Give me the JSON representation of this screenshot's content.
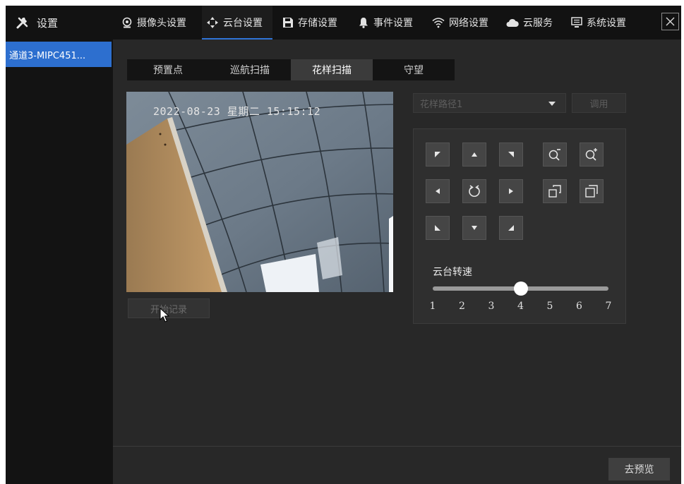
{
  "app": {
    "title": "设置"
  },
  "topnav": {
    "tabs": [
      {
        "label": "摄像头设置",
        "icon": "camera-icon"
      },
      {
        "label": "云台设置",
        "icon": "ptz-icon",
        "active": true
      },
      {
        "label": "存储设置",
        "icon": "floppy-icon"
      },
      {
        "label": "事件设置",
        "icon": "bell-icon"
      },
      {
        "label": "网络设置",
        "icon": "wifi-icon"
      },
      {
        "label": "云服务",
        "icon": "cloud-icon"
      },
      {
        "label": "系统设置",
        "icon": "monitor-icon"
      }
    ]
  },
  "sidebar": {
    "items": [
      {
        "label": "通道3-MIPC451..."
      }
    ]
  },
  "subtabs": [
    {
      "label": "预置点"
    },
    {
      "label": "巡航扫描"
    },
    {
      "label": "花样扫描",
      "active": true
    },
    {
      "label": "守望"
    }
  ],
  "video": {
    "osd_text": "2022-08-23 星期二 15:15:12"
  },
  "record_button": "开始记录",
  "path_select": {
    "value": "花样路径1"
  },
  "call_button": "调用",
  "ptz": {
    "speed_label": "云台转速",
    "speed_ticks": [
      "1",
      "2",
      "3",
      "4",
      "5",
      "6",
      "7"
    ],
    "speed_value": 4
  },
  "footer": {
    "preview_button": "去预览"
  },
  "colors": {
    "accent": "#2d6fcf",
    "background": "#282828",
    "topbar": "#121212"
  }
}
